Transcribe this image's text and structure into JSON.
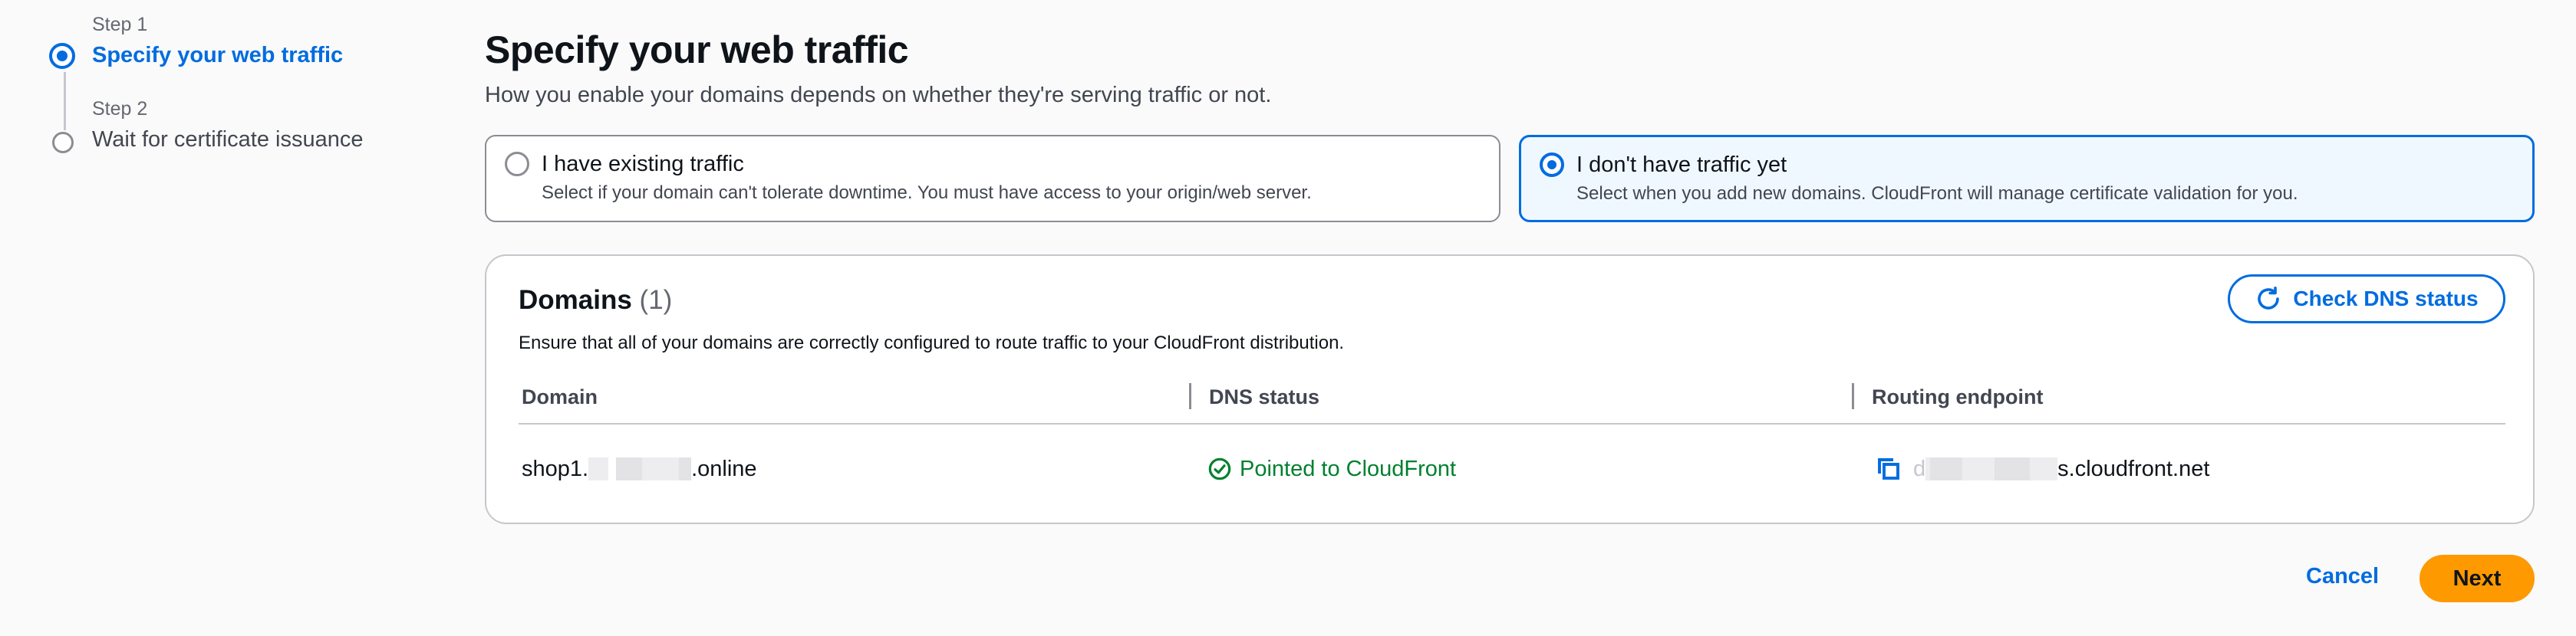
{
  "steps": [
    {
      "number": "Step 1",
      "title": "Specify your web traffic"
    },
    {
      "number": "Step 2",
      "title": "Wait for certificate issuance"
    }
  ],
  "header": {
    "title": "Specify your web traffic",
    "description": "How you enable your domains depends on whether they're serving traffic or not."
  },
  "traffic_options": [
    {
      "label": "I have existing traffic",
      "description": "Select if your domain can't tolerate downtime. You must have access to your origin/web server.",
      "selected": false
    },
    {
      "label": "I don't have traffic yet",
      "description": "Select when you add new domains. CloudFront will manage certificate validation for you.",
      "selected": true
    }
  ],
  "domains": {
    "title": "Domains",
    "count": "(1)",
    "description": "Ensure that all of your domains are correctly configured to route traffic to your CloudFront distribution.",
    "check_button": "Check DNS status",
    "columns": [
      "Domain",
      "DNS status",
      "Routing endpoint"
    ],
    "rows": [
      {
        "domain_prefix": "shop1.",
        "domain_suffix": ".online",
        "dns_status": "Pointed to CloudFront",
        "endpoint_prefix": "d",
        "endpoint_suffix": "s.cloudfront.net"
      }
    ]
  },
  "footer": {
    "cancel_label": "Cancel",
    "next_label": "Next"
  },
  "colors": {
    "accent": "#006ce0",
    "success": "#00802f",
    "primary_button": "#ff9900"
  },
  "icons": {
    "refresh": "refresh-icon",
    "status_ok": "check-circle-icon",
    "copy": "copy-icon"
  }
}
